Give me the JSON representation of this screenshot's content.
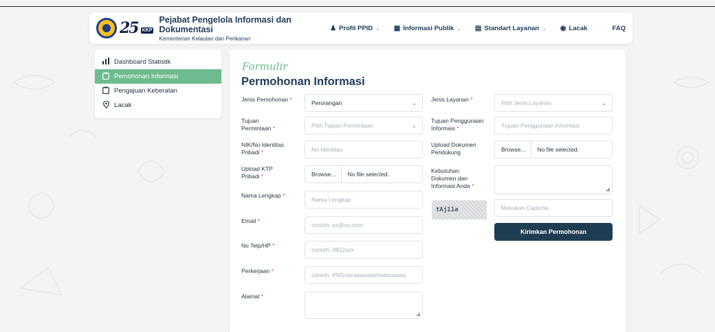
{
  "header": {
    "brand_title": "Pejabat Pengelola Informasi dan Dokumentasi",
    "brand_subtitle": "Kementerian Kelautan dan Perikanan",
    "logo_text": "25",
    "logo_badge": "KKP",
    "nav": [
      {
        "label": "Profil PPID",
        "icon": "people-icon",
        "has_dropdown": true
      },
      {
        "label": "Informasi Publik",
        "icon": "grid-icon",
        "has_dropdown": true
      },
      {
        "label": "Standart Layanan",
        "icon": "document-icon",
        "has_dropdown": true
      },
      {
        "label": "Lacak",
        "icon": "pin-icon",
        "has_dropdown": false
      },
      {
        "label": "FAQ",
        "has_dropdown": false
      }
    ]
  },
  "sidebar": {
    "items": [
      {
        "label": "Dashboard Statistik",
        "icon": "bar-chart-icon",
        "active": false
      },
      {
        "label": "Pemohonan Informasi",
        "icon": "clipboard-icon",
        "active": true
      },
      {
        "label": "Pengajuan Keberatan",
        "icon": "clipboard-icon",
        "active": false
      },
      {
        "label": "Lacak",
        "icon": "location-pin-icon",
        "active": false
      }
    ]
  },
  "form": {
    "script_heading": "Formulir",
    "title": "Permohonan Informasi",
    "required_mark": "*",
    "left": {
      "jenis_pemohonan": {
        "label": "Jenis Pemohonan",
        "value": "Perorangan"
      },
      "tujuan_permintaan": {
        "label_line1": "Tujuan",
        "label_line2": "Permintaan",
        "placeholder": "Pilih Tujuan Permintaan"
      },
      "nik": {
        "label_line1": "NIK/No Identitas",
        "label_line2": "Pribadi",
        "placeholder": "No Identitas"
      },
      "upload_ktp": {
        "label_line1": "Upload KTP",
        "label_line2": "Pribadi",
        "browse": "Browse...",
        "file_status": "No file selected."
      },
      "nama": {
        "label": "Nama Lengkap",
        "placeholder": "Nama Lengkap"
      },
      "email": {
        "label": "Email",
        "placeholder": "contoh: xx@xx.com"
      },
      "telp": {
        "label": "No Telp/HP",
        "placeholder": "contoh: 0812xxx"
      },
      "pekerjaan": {
        "label": "Perkerjaan",
        "placeholder": "contoh: PNS/wiraswasta/mahasiswa"
      },
      "alamat": {
        "label": "Alamat"
      }
    },
    "right": {
      "jenis_layanan": {
        "label": "Jenis Layanan",
        "placeholder": "Pilih Jenis Layanan"
      },
      "tujuan_penggunaan": {
        "label_line1": "Tujuan Penggunaan",
        "label_line2": "Informasi",
        "placeholder": "Tujuan Penggunaan Informasi"
      },
      "upload_dokumen": {
        "label_line1": "Upload Dokumen",
        "label_line2": "Pendukung",
        "browse": "Browse...",
        "file_status": "No file selected."
      },
      "kebutuhan": {
        "label_line1": "Kebutuhan",
        "label_line2": "Dokumen dan",
        "label_line3": "Informasi Anda"
      },
      "captcha": {
        "code": "tAj11a",
        "placeholder": "Masukan Captcha"
      },
      "submit_label": "Kirimkan Permohonan"
    }
  }
}
